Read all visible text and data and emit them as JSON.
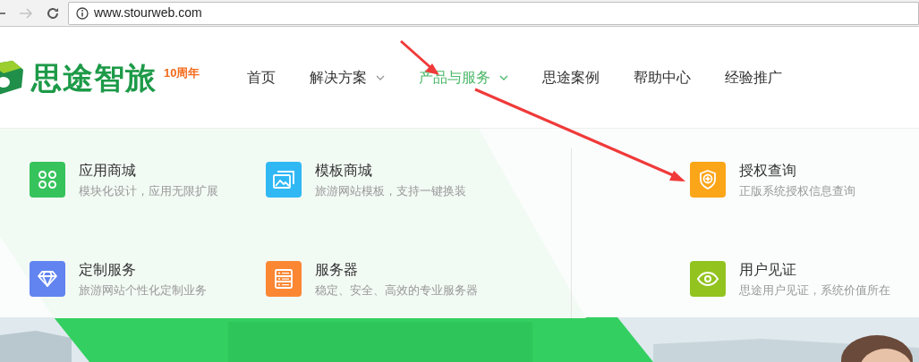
{
  "browser": {
    "url": "www.stourweb.com"
  },
  "header": {
    "logo_text": "思途智旅",
    "logo_badge": "10周年"
  },
  "nav": [
    {
      "label": "首页",
      "selected": false,
      "dropdown": false
    },
    {
      "label": "解决方案",
      "selected": false,
      "dropdown": true
    },
    {
      "label": "产品与服务",
      "selected": true,
      "dropdown": true
    },
    {
      "label": "思途案例",
      "selected": false,
      "dropdown": false
    },
    {
      "label": "帮助中心",
      "selected": false,
      "dropdown": false
    },
    {
      "label": "经验推广",
      "selected": false,
      "dropdown": false
    }
  ],
  "menu": {
    "columns": [
      [
        {
          "title": "应用商城",
          "description": "模块化设计，应用无限扩展",
          "color": "#36c35c"
        },
        {
          "title": "定制服务",
          "description": "旅游网站个性化定制业务",
          "color": "#6184f0"
        }
      ],
      [
        {
          "title": "模板商城",
          "description": "旅游网站模板，支持一键换装",
          "color": "#30b8f4"
        },
        {
          "title": "服务器",
          "description": "稳定、安全、高效的专业服务器",
          "color": "#fb8733"
        }
      ],
      [
        {
          "title": "授权查询",
          "description": "正版系统授权信息查询",
          "color": "#fba519"
        },
        {
          "title": "用户见证",
          "description": "思途用户见证，系统价值所在",
          "color": "#92c31f"
        }
      ]
    ]
  }
}
